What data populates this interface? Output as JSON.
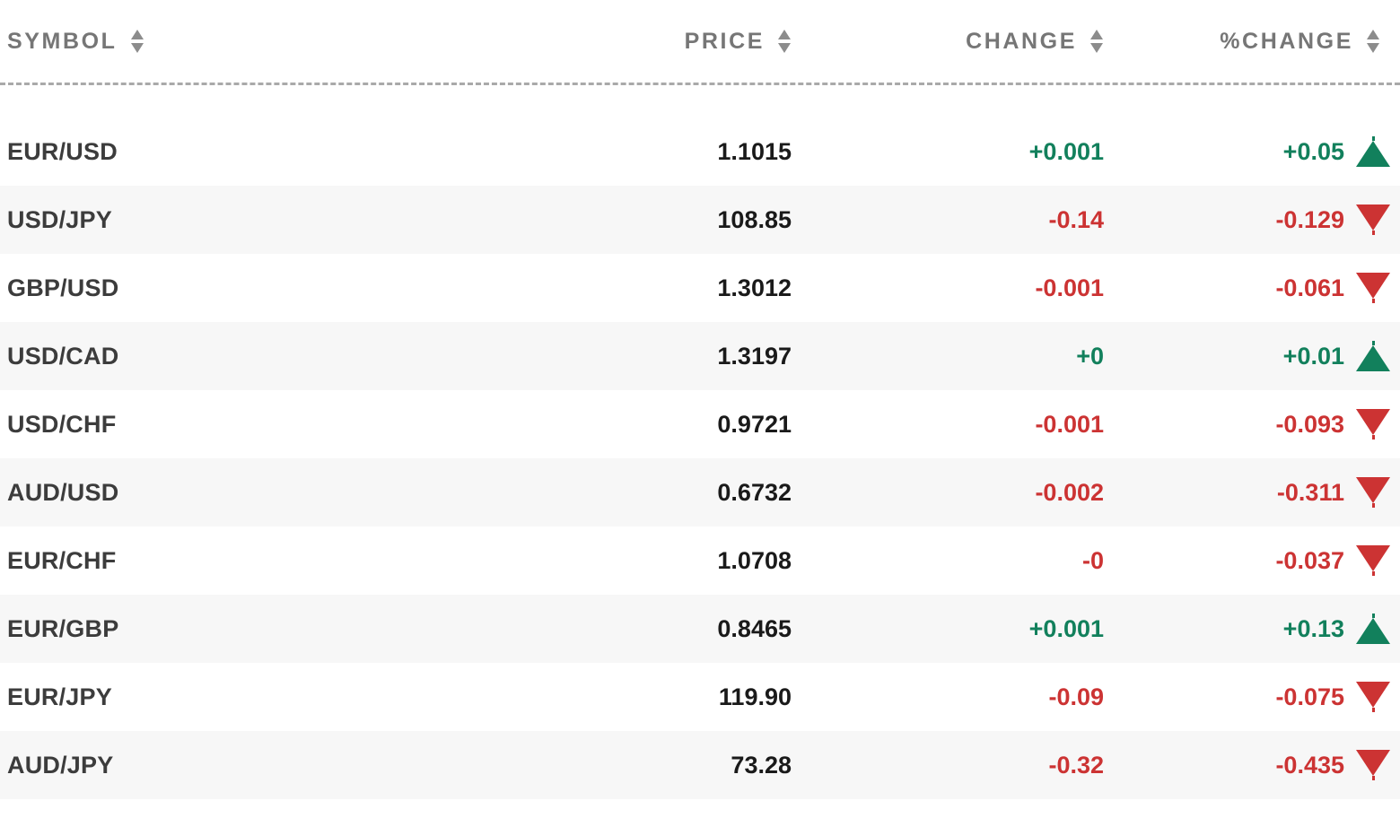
{
  "table": {
    "columns": [
      {
        "key": "symbol",
        "label": "SYMBOL",
        "sort_icon": "sort-arrows-icon"
      },
      {
        "key": "price",
        "label": "PRICE",
        "sort_icon": "sort-arrows-icon"
      },
      {
        "key": "change",
        "label": "CHANGE",
        "sort_icon": "sort-arrows-icon"
      },
      {
        "key": "pchange",
        "label": "%CHANGE",
        "sort_icon": "sort-arrows-icon"
      }
    ],
    "colors": {
      "positive": "#12805c",
      "negative": "#cc3333",
      "symbol_text": "#3c3c3c",
      "price_text": "#1a1a1a",
      "header_text": "#767676",
      "row_alt_background": "#f7f7f7",
      "row_background": "#ffffff",
      "divider": "#a9a9a9"
    },
    "rows": [
      {
        "symbol": "EUR/USD",
        "price": "1.1015",
        "change": "+0.001",
        "pchange": "+0.05",
        "direction": "up"
      },
      {
        "symbol": "USD/JPY",
        "price": "108.85",
        "change": "-0.14",
        "pchange": "-0.129",
        "direction": "down"
      },
      {
        "symbol": "GBP/USD",
        "price": "1.3012",
        "change": "-0.001",
        "pchange": "-0.061",
        "direction": "down"
      },
      {
        "symbol": "USD/CAD",
        "price": "1.3197",
        "change": "+0",
        "pchange": "+0.01",
        "direction": "up"
      },
      {
        "symbol": "USD/CHF",
        "price": "0.9721",
        "change": "-0.001",
        "pchange": "-0.093",
        "direction": "down"
      },
      {
        "symbol": "AUD/USD",
        "price": "0.6732",
        "change": "-0.002",
        "pchange": "-0.311",
        "direction": "down"
      },
      {
        "symbol": "EUR/CHF",
        "price": "1.0708",
        "change": "-0",
        "pchange": "-0.037",
        "direction": "down"
      },
      {
        "symbol": "EUR/GBP",
        "price": "0.8465",
        "change": "+0.001",
        "pchange": "+0.13",
        "direction": "up"
      },
      {
        "symbol": "EUR/JPY",
        "price": "119.90",
        "change": "-0.09",
        "pchange": "-0.075",
        "direction": "down"
      },
      {
        "symbol": "AUD/JPY",
        "price": "73.28",
        "change": "-0.32",
        "pchange": "-0.435",
        "direction": "down"
      }
    ]
  }
}
